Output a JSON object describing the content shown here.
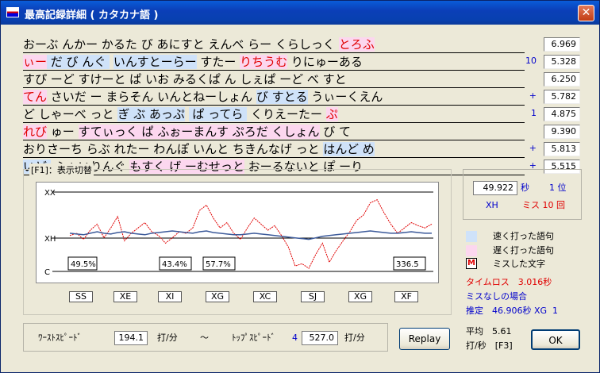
{
  "window": {
    "title": "最高記録詳細 ( カタカナ語 )",
    "close": "✕"
  },
  "rows": [
    {
      "segs": [
        {
          "t": "おーぶ んかー かるた び あにすと えんべ らー くらしっく ",
          "c": ""
        },
        {
          "t": "とろふ",
          "c": "pink",
          "r": true
        }
      ],
      "num": "",
      "val": "6.969"
    },
    {
      "segs": [
        {
          "t": "ぃー",
          "c": "pink",
          "r": true
        },
        {
          "t": " だ び んぐ ",
          "c": "blue"
        },
        {
          "t": " ",
          "c": ""
        },
        {
          "t": "いんすとーらー",
          "c": "blue"
        },
        {
          "t": " すたー ",
          "c": ""
        },
        {
          "t": "りちうむ",
          "c": "pink",
          "r": true
        },
        {
          "t": " りにゅーある",
          "c": ""
        }
      ],
      "num": "10",
      "val": "5.328"
    },
    {
      "segs": [
        {
          "t": "すぴ ーど すけーと ぱ いお みるくぱ ん しぇぱ ーど べ すと",
          "c": ""
        }
      ],
      "num": "",
      "val": "6.250"
    },
    {
      "segs": [
        {
          "t": "てん",
          "c": "pink",
          "r": true
        },
        {
          "t": " さいだ ー まらそん いんとねーしょん ",
          "c": ""
        },
        {
          "t": "び すとる",
          "c": "blue"
        },
        {
          "t": " うぃーくえん",
          "c": ""
        }
      ],
      "num": "+",
      "val": "5.782"
    },
    {
      "segs": [
        {
          "t": "ど しゃーべ っと ",
          "c": ""
        },
        {
          "t": "ぎ ぶ あっぷ",
          "c": "blue"
        },
        {
          "t": " ",
          "c": ""
        },
        {
          "t": " ぱ ってら ",
          "c": "blue"
        },
        {
          "t": " くりえーたー ",
          "c": ""
        },
        {
          "t": "ぷ",
          "c": "pink",
          "r": true
        }
      ],
      "num": "1",
      "val": "4.875"
    },
    {
      "segs": [
        {
          "t": "れび",
          "c": "pink",
          "r": true
        },
        {
          "t": " ゅー ",
          "c": ""
        },
        {
          "t": "すてぃっく ぱ ふぉーまんす ぷろだ くしょん",
          "c": "pink"
        },
        {
          "t": " び て",
          "c": ""
        }
      ],
      "num": "",
      "val": "9.390"
    },
    {
      "segs": [
        {
          "t": "おりさーち らぶ れたー わんぽ いんと ちきんなげ っと ",
          "c": ""
        },
        {
          "t": "はんど め",
          "c": "blue"
        }
      ],
      "num": "+",
      "val": "5.813"
    },
    {
      "segs": [
        {
          "t": "いど ",
          "c": "blue"
        },
        {
          "t": " ふぁいりんぐ ",
          "c": ""
        },
        {
          "t": "もすく げ ーむせっと",
          "c": "pink"
        },
        {
          "t": " おーるないと ぽ ーり",
          "c": ""
        }
      ],
      "num": "+",
      "val": "5.515"
    }
  ],
  "chart": {
    "group_label": "[F1]：表示切替",
    "y_labels": {
      "top": "XX",
      "mid": "XH",
      "bot": "C"
    },
    "percents": [
      "49.5%",
      "43.4%",
      "57.7%"
    ],
    "right_value": "336.5",
    "sections": [
      "SS",
      "XE",
      "XI",
      "XG",
      "XC",
      "SJ",
      "XG",
      "XF"
    ],
    "color_red": "#e00000",
    "color_blue": "#3c5a9a"
  },
  "chart_data": {
    "type": "line",
    "series": [
      {
        "values": [
          0.45,
          0.48,
          0.4,
          0.52,
          0.6,
          0.42,
          0.55,
          0.7,
          0.38,
          0.48,
          0.55,
          0.62,
          0.5,
          0.45,
          0.35,
          0.42,
          0.5,
          0.48,
          0.55,
          0.78,
          0.85,
          0.68,
          0.55,
          0.62,
          0.48,
          0.4,
          0.55,
          0.68,
          0.6,
          0.52,
          0.58,
          0.45,
          0.3,
          0.05,
          0.08,
          0.02,
          0.2,
          0.35,
          0.1,
          0.25,
          0.38,
          0.5,
          0.65,
          0.72,
          0.88,
          0.92,
          0.75,
          0.6,
          0.48,
          0.55,
          0.62,
          0.58,
          0.55,
          0.6
        ]
      },
      {
        "values": [
          0.48,
          0.47,
          0.46,
          0.48,
          0.5,
          0.48,
          0.47,
          0.49,
          0.5,
          0.48,
          0.47,
          0.46,
          0.48,
          0.49,
          0.5,
          0.51,
          0.5,
          0.49,
          0.48,
          0.5,
          0.51,
          0.49,
          0.48,
          0.47,
          0.46,
          0.46,
          0.47,
          0.48,
          0.47,
          0.46,
          0.45,
          0.44,
          0.43,
          0.42,
          0.41,
          0.4,
          0.42,
          0.44,
          0.45,
          0.46,
          0.47,
          0.48,
          0.49,
          0.5,
          0.51,
          0.5,
          0.49,
          0.48,
          0.48,
          0.49,
          0.5,
          0.49,
          0.48,
          0.48
        ]
      }
    ]
  },
  "lower": {
    "worst_label": "ﾜｰｽﾄｽﾋﾟｰﾄﾞ",
    "worst": "194.1",
    "unit": "打/分",
    "tilde": "～",
    "top_label": "ﾄｯﾌﾟｽﾋﾟｰﾄﾞ",
    "top_num": "4",
    "top": "527.0",
    "unit2": "打/分"
  },
  "replay": "Replay",
  "result": {
    "time": "49.922",
    "sec": "秒",
    "rank": "1 位",
    "grade": "XH",
    "miss": "ミス 10 回"
  },
  "legend": [
    {
      "label": "速く打った語句",
      "color": "#cfe2f9"
    },
    {
      "label": "遅く打った語句",
      "color": "#fcd7ef"
    },
    {
      "label": "ミスした文字",
      "mark": "M"
    }
  ],
  "stats": {
    "timeloss": "タイムロス　3.016秒",
    "nomiss_title": "ミスなしの場合",
    "nomiss": "推定　46.906秒 XG  1",
    "avg1": "平均　5.61",
    "avg2": "打/秒　[F3]"
  },
  "ok": "OK"
}
